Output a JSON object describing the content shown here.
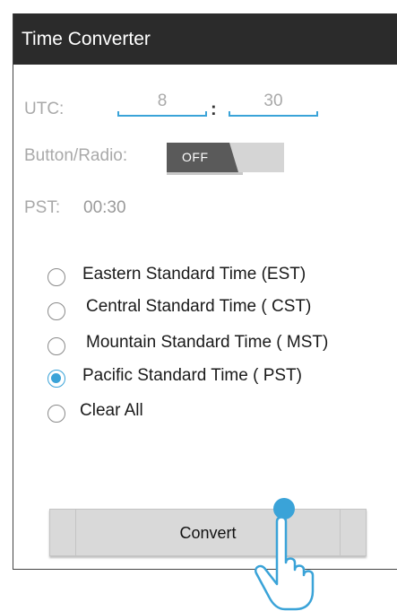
{
  "app": {
    "title": "Time Converter"
  },
  "utc": {
    "label": "UTC:",
    "hour": "8",
    "separator": ":",
    "minute": "30"
  },
  "toggle": {
    "label": "Button/Radio:",
    "state": "OFF"
  },
  "result": {
    "label": "PST:",
    "value": "00:30"
  },
  "timezones": [
    {
      "label": "Eastern Standard Time (EST)",
      "checked": false
    },
    {
      "label": "Central Standard Time ( CST)",
      "checked": false
    },
    {
      "label": "Mountain Standard Time ( MST)",
      "checked": false
    },
    {
      "label": "Pacific Standard Time ( PST)",
      "checked": true
    },
    {
      "label": "Clear All",
      "checked": false
    }
  ],
  "actions": {
    "convert_label": "Convert"
  },
  "colors": {
    "title_bar": "#2b2b2b",
    "accent": "#3aa3d8",
    "muted_text": "#a9a9a9"
  },
  "icons": {
    "pointer": "hand-pointer-icon"
  }
}
